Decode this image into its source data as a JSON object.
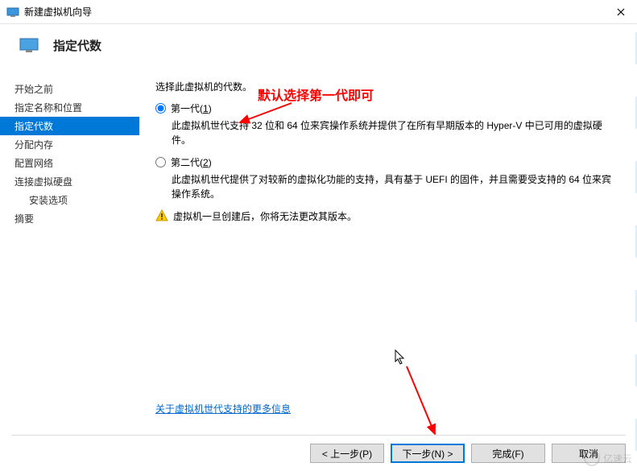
{
  "window": {
    "title": "新建虚拟机向导"
  },
  "header": {
    "title": "指定代数"
  },
  "sidebar": {
    "items": [
      {
        "label": "开始之前"
      },
      {
        "label": "指定名称和位置"
      },
      {
        "label": "指定代数"
      },
      {
        "label": "分配内存"
      },
      {
        "label": "配置网络"
      },
      {
        "label": "连接虚拟硬盘"
      },
      {
        "label": "安装选项"
      },
      {
        "label": "摘要"
      }
    ],
    "selected_index": 2
  },
  "content": {
    "intro": "选择此虚拟机的代数。",
    "options": [
      {
        "label_prefix": "第一代(",
        "accel": "1",
        "label_suffix": ")",
        "desc": "此虚拟机世代支持 32 位和 64 位来宾操作系统并提供了在所有早期版本的 Hyper-V 中已可用的虚拟硬件。",
        "checked": true
      },
      {
        "label_prefix": "第二代(",
        "accel": "2",
        "label_suffix": ")",
        "desc": "此虚拟机世代提供了对较新的虚拟化功能的支持，具有基于 UEFI 的固件，并且需要受支持的 64 位来宾操作系统。",
        "checked": false
      }
    ],
    "warning": "虚拟机一旦创建后，你将无法更改其版本。",
    "link": "关于虚拟机世代支持的更多信息"
  },
  "annotations": {
    "note1": "默认选择第一代即可"
  },
  "footer": {
    "prev": "< 上一步(P)",
    "next": "下一步(N) >",
    "finish": "完成(F)",
    "cancel": "取消"
  },
  "watermark": "亿速云"
}
